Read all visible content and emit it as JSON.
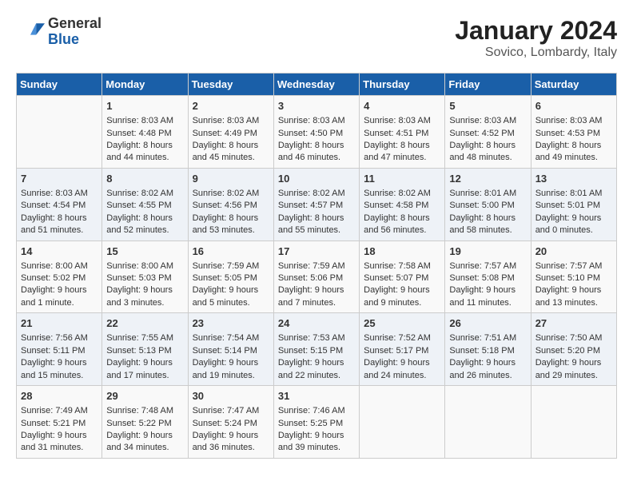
{
  "header": {
    "logo_general": "General",
    "logo_blue": "Blue",
    "calendar_title": "January 2024",
    "calendar_subtitle": "Sovico, Lombardy, Italy"
  },
  "days_of_week": [
    "Sunday",
    "Monday",
    "Tuesday",
    "Wednesday",
    "Thursday",
    "Friday",
    "Saturday"
  ],
  "weeks": [
    {
      "days": [
        {
          "num": "",
          "content": ""
        },
        {
          "num": "1",
          "content": "Sunrise: 8:03 AM\nSunset: 4:48 PM\nDaylight: 8 hours\nand 44 minutes."
        },
        {
          "num": "2",
          "content": "Sunrise: 8:03 AM\nSunset: 4:49 PM\nDaylight: 8 hours\nand 45 minutes."
        },
        {
          "num": "3",
          "content": "Sunrise: 8:03 AM\nSunset: 4:50 PM\nDaylight: 8 hours\nand 46 minutes."
        },
        {
          "num": "4",
          "content": "Sunrise: 8:03 AM\nSunset: 4:51 PM\nDaylight: 8 hours\nand 47 minutes."
        },
        {
          "num": "5",
          "content": "Sunrise: 8:03 AM\nSunset: 4:52 PM\nDaylight: 8 hours\nand 48 minutes."
        },
        {
          "num": "6",
          "content": "Sunrise: 8:03 AM\nSunset: 4:53 PM\nDaylight: 8 hours\nand 49 minutes."
        }
      ]
    },
    {
      "days": [
        {
          "num": "7",
          "content": "Sunrise: 8:03 AM\nSunset: 4:54 PM\nDaylight: 8 hours\nand 51 minutes."
        },
        {
          "num": "8",
          "content": "Sunrise: 8:02 AM\nSunset: 4:55 PM\nDaylight: 8 hours\nand 52 minutes."
        },
        {
          "num": "9",
          "content": "Sunrise: 8:02 AM\nSunset: 4:56 PM\nDaylight: 8 hours\nand 53 minutes."
        },
        {
          "num": "10",
          "content": "Sunrise: 8:02 AM\nSunset: 4:57 PM\nDaylight: 8 hours\nand 55 minutes."
        },
        {
          "num": "11",
          "content": "Sunrise: 8:02 AM\nSunset: 4:58 PM\nDaylight: 8 hours\nand 56 minutes."
        },
        {
          "num": "12",
          "content": "Sunrise: 8:01 AM\nSunset: 5:00 PM\nDaylight: 8 hours\nand 58 minutes."
        },
        {
          "num": "13",
          "content": "Sunrise: 8:01 AM\nSunset: 5:01 PM\nDaylight: 9 hours\nand 0 minutes."
        }
      ]
    },
    {
      "days": [
        {
          "num": "14",
          "content": "Sunrise: 8:00 AM\nSunset: 5:02 PM\nDaylight: 9 hours\nand 1 minute."
        },
        {
          "num": "15",
          "content": "Sunrise: 8:00 AM\nSunset: 5:03 PM\nDaylight: 9 hours\nand 3 minutes."
        },
        {
          "num": "16",
          "content": "Sunrise: 7:59 AM\nSunset: 5:05 PM\nDaylight: 9 hours\nand 5 minutes."
        },
        {
          "num": "17",
          "content": "Sunrise: 7:59 AM\nSunset: 5:06 PM\nDaylight: 9 hours\nand 7 minutes."
        },
        {
          "num": "18",
          "content": "Sunrise: 7:58 AM\nSunset: 5:07 PM\nDaylight: 9 hours\nand 9 minutes."
        },
        {
          "num": "19",
          "content": "Sunrise: 7:57 AM\nSunset: 5:08 PM\nDaylight: 9 hours\nand 11 minutes."
        },
        {
          "num": "20",
          "content": "Sunrise: 7:57 AM\nSunset: 5:10 PM\nDaylight: 9 hours\nand 13 minutes."
        }
      ]
    },
    {
      "days": [
        {
          "num": "21",
          "content": "Sunrise: 7:56 AM\nSunset: 5:11 PM\nDaylight: 9 hours\nand 15 minutes."
        },
        {
          "num": "22",
          "content": "Sunrise: 7:55 AM\nSunset: 5:13 PM\nDaylight: 9 hours\nand 17 minutes."
        },
        {
          "num": "23",
          "content": "Sunrise: 7:54 AM\nSunset: 5:14 PM\nDaylight: 9 hours\nand 19 minutes."
        },
        {
          "num": "24",
          "content": "Sunrise: 7:53 AM\nSunset: 5:15 PM\nDaylight: 9 hours\nand 22 minutes."
        },
        {
          "num": "25",
          "content": "Sunrise: 7:52 AM\nSunset: 5:17 PM\nDaylight: 9 hours\nand 24 minutes."
        },
        {
          "num": "26",
          "content": "Sunrise: 7:51 AM\nSunset: 5:18 PM\nDaylight: 9 hours\nand 26 minutes."
        },
        {
          "num": "27",
          "content": "Sunrise: 7:50 AM\nSunset: 5:20 PM\nDaylight: 9 hours\nand 29 minutes."
        }
      ]
    },
    {
      "days": [
        {
          "num": "28",
          "content": "Sunrise: 7:49 AM\nSunset: 5:21 PM\nDaylight: 9 hours\nand 31 minutes."
        },
        {
          "num": "29",
          "content": "Sunrise: 7:48 AM\nSunset: 5:22 PM\nDaylight: 9 hours\nand 34 minutes."
        },
        {
          "num": "30",
          "content": "Sunrise: 7:47 AM\nSunset: 5:24 PM\nDaylight: 9 hours\nand 36 minutes."
        },
        {
          "num": "31",
          "content": "Sunrise: 7:46 AM\nSunset: 5:25 PM\nDaylight: 9 hours\nand 39 minutes."
        },
        {
          "num": "",
          "content": ""
        },
        {
          "num": "",
          "content": ""
        },
        {
          "num": "",
          "content": ""
        }
      ]
    }
  ],
  "colors": {
    "header_bg": "#1a5fa8",
    "header_text": "#ffffff",
    "week_even_bg": "#eef2f7",
    "week_odd_bg": "#ffffff"
  }
}
